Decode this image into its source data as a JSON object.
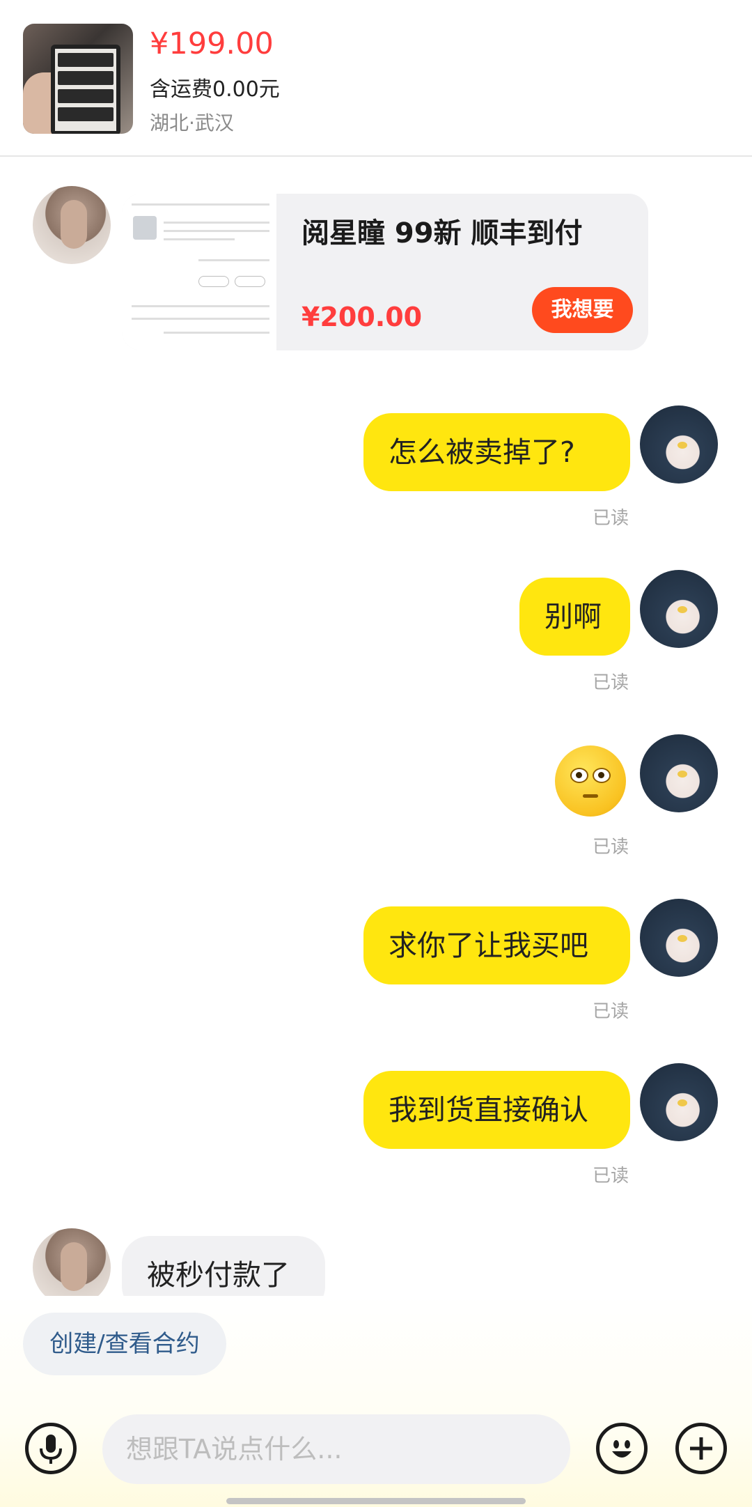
{
  "product": {
    "price": "¥199.00",
    "shipping": "含运费0.00元",
    "location": "湖北·武汉"
  },
  "card": {
    "title": "阅星瞳 99新 顺丰到付",
    "price": "¥200.00",
    "button": "我想要"
  },
  "messages": {
    "m1": {
      "text": "怎么被卖掉了?",
      "status": "已读"
    },
    "m2": {
      "text": "别啊",
      "status": "已读"
    },
    "m3": {
      "emoji": "eyes-emoji",
      "status": "已读"
    },
    "m4": {
      "text": "求你了让我买吧",
      "status": "已读"
    },
    "m5": {
      "text": "我到货直接确认",
      "status": "已读"
    },
    "m6": {
      "text": "被秒付款了"
    }
  },
  "contract_button": "创建/查看合约",
  "composer": {
    "placeholder": "想跟TA说点什么...",
    "voice_icon": "microphone-icon",
    "emoji_icon": "emoji-icon",
    "plus_icon": "plus-icon"
  },
  "colors": {
    "accent_yellow": "#ffe60f",
    "price_red": "#ff3d3d",
    "want_orange": "#ff4a1e",
    "contract_blue": "#2f5b8b"
  }
}
